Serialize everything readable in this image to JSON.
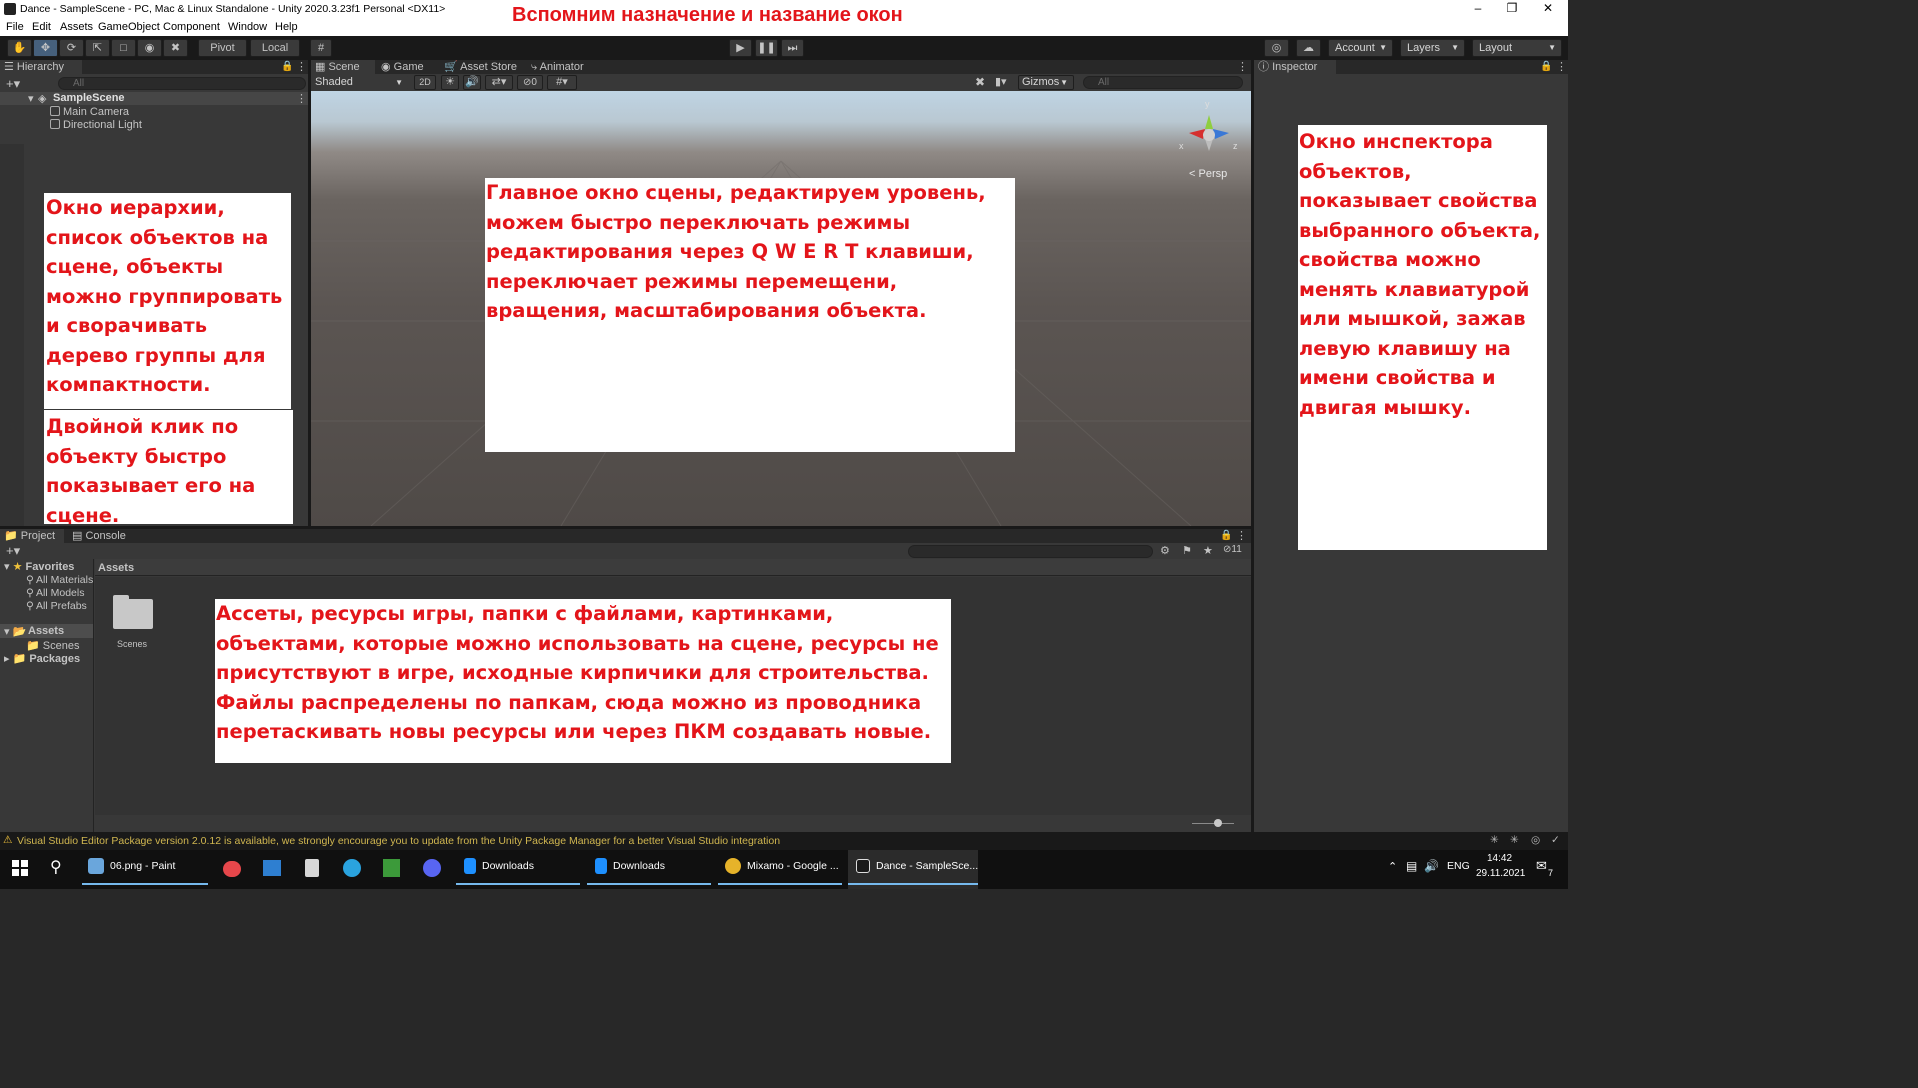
{
  "title_bar": {
    "title": "Dance - SampleScene - PC, Mac & Linux Standalone - Unity 2020.3.23f1 Personal <DX11>",
    "overlay_heading": "Вспомним назначение и название окон"
  },
  "menu": [
    "File",
    "Edit",
    "Assets",
    "GameObject",
    "Component",
    "Window",
    "Help"
  ],
  "toolbar": {
    "pivot": "Pivot",
    "local": "Local",
    "account": "Account",
    "layers": "Layers",
    "layout": "Layout"
  },
  "hierarchy": {
    "tab": "Hierarchy",
    "search_placeholder": "All",
    "scene": "SampleScene",
    "items": [
      "Main Camera",
      "Directional Light"
    ]
  },
  "scene_tabs": {
    "tabs": [
      "Scene",
      "Game",
      "Asset Store",
      "Animator"
    ],
    "shading": "Shaded",
    "mode_2d": "2D",
    "hidden_count": "0",
    "gizmos": "Gizmos",
    "search_placeholder": "All",
    "persp": "Persp",
    "axis_x": "x",
    "axis_y": "y",
    "axis_z": "z"
  },
  "inspector": {
    "tab": "Inspector"
  },
  "project": {
    "tabs": [
      "Project",
      "Console"
    ],
    "favorites_label": "Favorites",
    "favorites": [
      "All Materials",
      "All Models",
      "All Prefabs"
    ],
    "assets_label": "Assets",
    "asset_children": [
      "Scenes"
    ],
    "packages_label": "Packages",
    "breadcrumb": "Assets",
    "hidden_count": "11",
    "folder_name": "Scenes"
  },
  "notes": {
    "hierarchy_1": "Окно иерархии, список объектов на сцене, объекты можно группировать и сворачивать дерево группы для компактности.",
    "hierarchy_2": "Двойной клик по объекту быстро показывает его на сцене.",
    "scene": "Главное окно сцены, редактируем уровень, можем быстро переключать режимы редактирования через Q W E R T клавиши, переключает режимы перемещени, вращения, масштабирования объекта.",
    "inspector": "Окно инспектора объектов, показывает свойства выбранного объекта, свойства можно менять клавиатурой или мышкой, зажав левую клавишу на имени свойства и двигая мышку.",
    "assets": "Ассеты, ресурсы игры, папки с файлами, картинками, объектами, которые можно использовать на сцене, ресурсы не присутствуют в игре, исходные кирпичики для строительства. Файлы распределены по папкам, сюда можно из проводника перетаскивать новы ресурсы или через ПКМ создавать новые."
  },
  "status_bar": {
    "message": "Visual Studio Editor Package version 2.0.12 is available, we strongly encourage you to update from the Unity Package Manager for a better Visual Studio integration"
  },
  "taskbar": {
    "items": [
      "06.png - Paint",
      "Downloads",
      "Downloads",
      "Mixamo - Google ...",
      "Dance - SampleSce..."
    ],
    "lang": "ENG",
    "time": "14:42",
    "date": "29.11.2021",
    "notifications": "7"
  }
}
